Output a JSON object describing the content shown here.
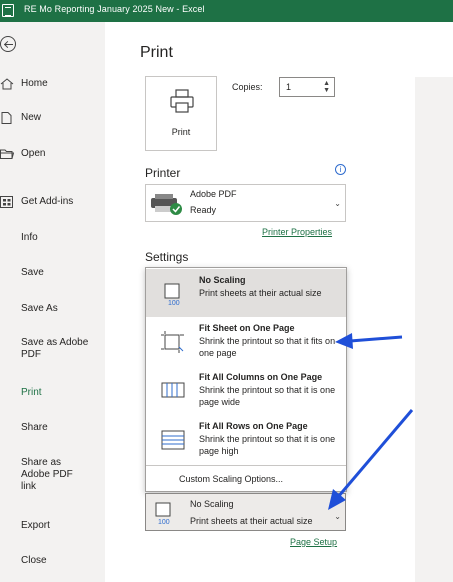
{
  "window": {
    "title": "RE Mo Reporting January 2025 New  -  Excel"
  },
  "nav": {
    "items": [
      {
        "label": "Home",
        "icon": "home-icon"
      },
      {
        "label": "New",
        "icon": "new-doc-icon"
      },
      {
        "label": "Open",
        "icon": "open-folder-icon"
      },
      {
        "label": "Get Add-ins",
        "icon": "add-ins-icon"
      },
      {
        "label": "Info"
      },
      {
        "label": "Save"
      },
      {
        "label": "Save As"
      },
      {
        "label": "Save as Adobe PDF"
      },
      {
        "label": "Print",
        "active": true
      },
      {
        "label": "Share"
      },
      {
        "label": "Share as Adobe PDF link"
      },
      {
        "label": "Export"
      },
      {
        "label": "Close"
      }
    ]
  },
  "print": {
    "heading": "Print",
    "button_label": "Print",
    "copies_label": "Copies:",
    "copies_value": "1"
  },
  "printer": {
    "heading": "Printer",
    "name": "Adobe PDF",
    "status": "Ready",
    "properties_link": "Printer Properties"
  },
  "settings": {
    "heading": "Settings",
    "scaling_options": [
      {
        "title": "No Scaling",
        "desc": "Print sheets at their actual size",
        "icon": "no-scaling-icon",
        "selected": true
      },
      {
        "title": "Fit Sheet on One Page",
        "desc": "Shrink the printout so that it fits on one page",
        "icon": "fit-sheet-icon"
      },
      {
        "title": "Fit All Columns on One Page",
        "desc": "Shrink the printout so that it is one page wide",
        "icon": "fit-columns-icon"
      },
      {
        "title": "Fit All Rows on One Page",
        "desc": "Shrink the printout so that it is one page high",
        "icon": "fit-rows-icon"
      }
    ],
    "custom_option": "Custom Scaling Options...",
    "current_title": "No Scaling",
    "current_desc": "Print sheets at their actual size",
    "page_setup_link": "Page Setup"
  },
  "colors": {
    "title_bar": "#1e7145",
    "accent_link": "#1e7145",
    "annotation_arrow": "#1f4fd8"
  }
}
